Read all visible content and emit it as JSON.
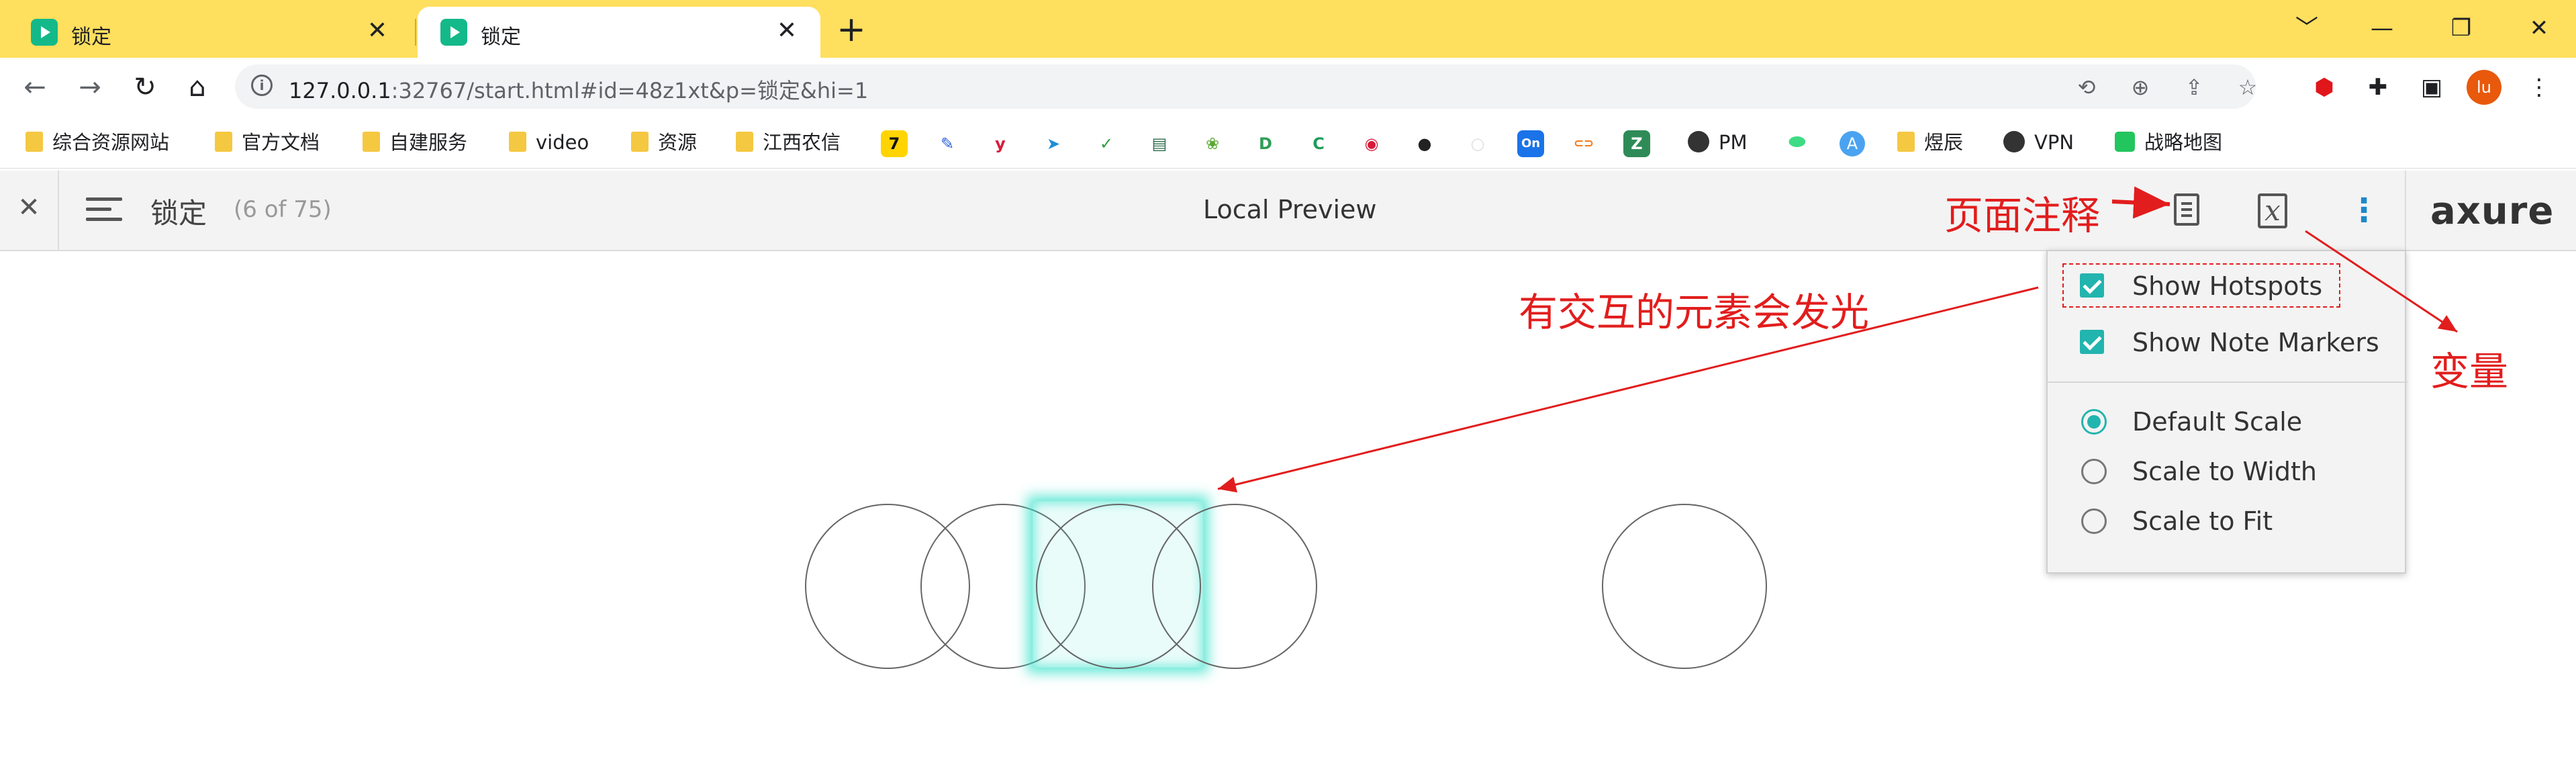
{
  "browser": {
    "tabs": [
      {
        "title": "锁定",
        "active": false
      },
      {
        "title": "锁定",
        "active": true
      }
    ],
    "tab_close_glyph": "✕",
    "new_tab_glyph": "+",
    "window_controls": [
      "﹀",
      "—",
      "❐",
      "✕"
    ],
    "nav": {
      "back": "←",
      "forward": "→",
      "reload": "↻",
      "home": "⌂"
    },
    "url": {
      "host": "127.0.0.1",
      "rest": ":32767/start.html#id=48z1xt&p=锁定&hi=1"
    },
    "info_glyph": "i",
    "omnibox_icons": [
      "translate-icon",
      "zoom-icon",
      "share-icon",
      "star-icon"
    ],
    "extension_icons": [
      "shield-extension-icon",
      "puzzle-extension-icon",
      "side-panel-icon"
    ],
    "profile_initials": "lu",
    "menu_glyph": "⋮"
  },
  "bookmarks": {
    "items": [
      {
        "label": "综合资源网站",
        "type": "folder"
      },
      {
        "label": "官方文档",
        "type": "folder"
      },
      {
        "label": "自建服务",
        "type": "folder"
      },
      {
        "label": "video",
        "type": "folder"
      },
      {
        "label": "资源",
        "type": "folder"
      },
      {
        "label": "江西农信",
        "type": "folder"
      },
      {
        "label": "PM",
        "type": "link"
      },
      {
        "label": "煜辰",
        "type": "folder"
      },
      {
        "label": "VPN",
        "type": "link"
      },
      {
        "label": "战略地图",
        "type": "link"
      }
    ],
    "icon_only": [
      {
        "glyph": "7",
        "name": "bookmark-7-icon",
        "bg": "#ffd400",
        "fg": "#111111"
      },
      {
        "glyph": "✎",
        "name": "bookmark-pen-icon",
        "bg": "#ffffff",
        "fg": "#2b5fd9"
      },
      {
        "glyph": "y",
        "name": "bookmark-y-icon",
        "bg": "#ffffff",
        "fg": "#d81b3a"
      },
      {
        "glyph": "➤",
        "name": "bookmark-plane-icon",
        "bg": "#ffffff",
        "fg": "#1e8fd8"
      },
      {
        "glyph": "✓",
        "name": "bookmark-hao-icon",
        "bg": "#ffffff",
        "fg": "#2e9e3a"
      },
      {
        "glyph": "▤",
        "name": "bookmark-book-icon",
        "bg": "#ffffff",
        "fg": "#2d6b4b"
      },
      {
        "glyph": "❀",
        "name": "bookmark-spring-icon",
        "bg": "#ffffff",
        "fg": "#5aa832"
      },
      {
        "glyph": "D",
        "name": "bookmark-d-icon",
        "bg": "#ffffff",
        "fg": "#2f9e56"
      },
      {
        "glyph": "C",
        "name": "bookmark-c-icon",
        "bg": "#ffffff",
        "fg": "#1f9c5a"
      },
      {
        "glyph": "◉",
        "name": "bookmark-red-icon",
        "bg": "#ffffff",
        "fg": "#d81b3a"
      },
      {
        "glyph": "●",
        "name": "bookmark-github-icon",
        "bg": "#ffffff",
        "fg": "#222222"
      },
      {
        "glyph": "○",
        "name": "bookmark-blank-icon",
        "bg": "#ffffff",
        "fg": "#dddddd"
      },
      {
        "glyph": "On",
        "name": "bookmark-on-icon",
        "bg": "#1a73e8",
        "fg": "#ffffff"
      },
      {
        "glyph": "⊂⊃",
        "name": "bookmark-link-icon",
        "bg": "#ffffff",
        "fg": "#f07a1a"
      },
      {
        "glyph": "Z",
        "name": "bookmark-z-icon",
        "bg": "#2e8b57",
        "fg": "#ffffff"
      }
    ]
  },
  "axure": {
    "close_glyph": "✕",
    "page_name": "锁定",
    "page_count": "(6 of 75)",
    "title": "Local Preview",
    "variables_glyph": "x",
    "more_glyph": "⋮",
    "logo": "axure"
  },
  "dropdown": {
    "checkboxes": [
      {
        "label": "Show Hotspots",
        "checked": true
      },
      {
        "label": "Show Note Markers",
        "checked": true
      }
    ],
    "scales": [
      {
        "label": "Default Scale",
        "selected": true
      },
      {
        "label": "Scale to Width",
        "selected": false
      },
      {
        "label": "Scale to Fit",
        "selected": false
      }
    ]
  },
  "annotations": {
    "page_notes": "页面注释",
    "glow": "有交互的元素会发光",
    "variables": "变量",
    "color": "#e21d1d"
  },
  "colors": {
    "tabstrip": "#ffdf5e",
    "accent": "#22b4ae",
    "hotspot_glow": "#30e0c8"
  }
}
